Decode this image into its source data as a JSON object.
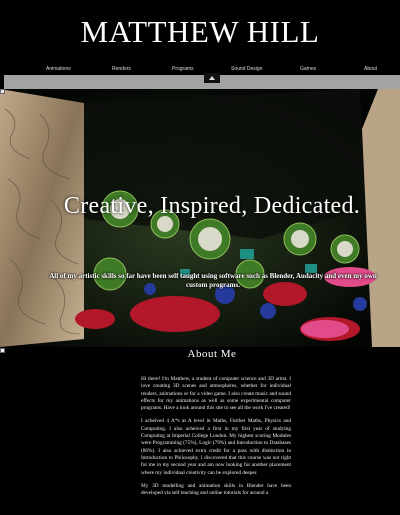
{
  "header": {
    "site_title": "MATTHEW HILL"
  },
  "nav": {
    "items": [
      {
        "label": "Animations"
      },
      {
        "label": "Renders"
      },
      {
        "label": "Programs"
      },
      {
        "label": "Sound Design"
      },
      {
        "label": "Games"
      },
      {
        "label": "About"
      }
    ]
  },
  "hero": {
    "tagline": "Creative, Inspired, Dedicated.",
    "description": "All of my artistic skills so far have been self taught using software such as Blender, Audacity and even my own custom programs."
  },
  "about": {
    "heading": "About Me",
    "paragraphs": [
      "Hi there! I'm Matthew, a student of computer science and 3D artist. I love creating 3D scenes and atmospheres, whether for individual renders, animations or for a video game. I also create music and sound effects for my animations as well as some experimental computer programs. Have a look around this site to see all the work I've created!",
      "I acheived 4 A*s at A level in Maths, Further Maths, Physics and Computing. I also acheived a first in my first year of studying Computing at Imperial College London. My highest scoring Modules were Programming (75%), Logic (79%) and Introduction to Databases (86%). I also achieved extra credit for a pass with distinction in Introduction to Philosophy. I discovered that this course was not right for me in my second year and am now looking for another placement where my individual creativity can be explored deeper.",
      "My 3D modelling and animation skills in Blender have been developed via self teaching and online tutorials for around a"
    ]
  },
  "colors": {
    "background": "#000000",
    "nav_bar": "#a3a3a3",
    "text": "#ffffff"
  }
}
